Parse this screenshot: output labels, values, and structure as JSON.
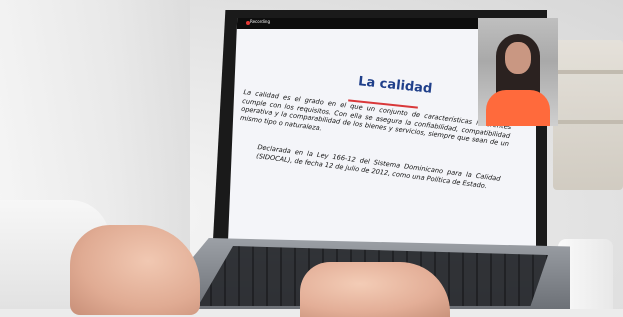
{
  "recording": {
    "label": "Recording"
  },
  "slide": {
    "title": "La calidad",
    "paragraph1": "La calidad es el grado en el que un conjunto de características inherentes cumple con los requisitos. Con ella se asegura la confiabilidad, compatibilidad operativa y la comparabilidad de los bienes y servicios, siempre que sean de un mismo tipo o naturaleza.",
    "paragraph2": "Declarada en la Ley 166-12 del Sistema Dominicano para la Calidad (SIDOCAL), de fecha 12 de julio de 2012, como una Política de Estado."
  },
  "colors": {
    "title": "#1f3f8a",
    "accent_red": "#d9383a",
    "accent_blue": "#1f3f8a",
    "presenter_top": "#ff6a3c"
  }
}
